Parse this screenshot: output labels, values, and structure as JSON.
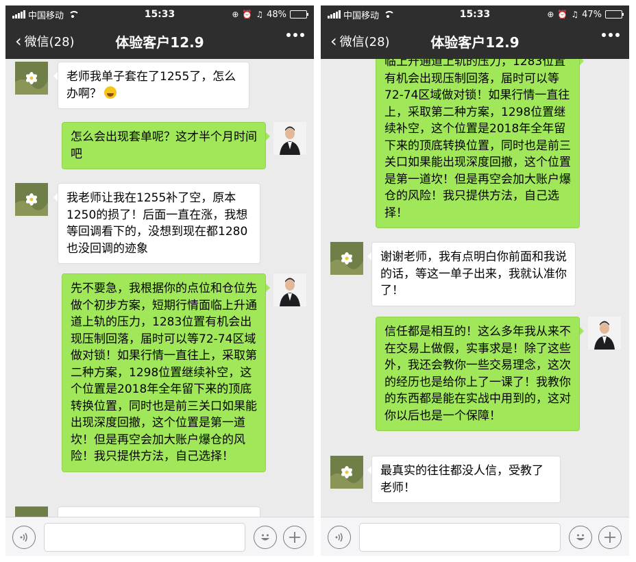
{
  "status": {
    "carrier": "中国移动",
    "time": "15:33",
    "battery_left": "48%",
    "battery_right": "47%",
    "battery_left_level": 0.48,
    "battery_right_level": 0.47
  },
  "nav": {
    "back_label": "微信(28)",
    "title": "体验客户12.9"
  },
  "left_messages": [
    {
      "side": "in",
      "text": "老师我单子套在了1255了，怎么办啊？",
      "emoji": "sweat-smile-emoji"
    },
    {
      "side": "out",
      "text": "怎么会出现套单呢？这才半个月时间吧"
    },
    {
      "side": "in",
      "text": "我老师让我在1255补了空，原本1250的损了！后面一直在涨，我想等回调看下的，没想到现在都1280也没回调的迹象"
    },
    {
      "side": "out",
      "text": "先不要急，我根据你的点位和仓位先做个初步方案，短期行情面临上升通道上轨的压力，1283位置有机会出现压制回落，届时可以等72-74区域做对锁！如果行情一直往上，采取第二种方案，1298位置继续补空，这个位置是2018年全年留下来的顶底转换位置，同时也是前三关口如果能出现深度回撤，这个位置是第一道坎！但是再空会加大账户爆仓的风险！我只提供方法，自己选择！"
    }
  ],
  "right_messages": [
    {
      "side": "out",
      "text": "临上升通道上轨的压力，1283位置有机会出现压制回落，届时可以等72-74区域做对锁！如果行情一直往上，采取第二种方案，1298位置继续补空，这个位置是2018年全年留下来的顶底转换位置，同时也是前三关口如果能出现深度回撤，这个位置是第一道坎！但是再空会加大账户爆仓的风险！我只提供方法，自己选择！"
    },
    {
      "side": "in",
      "text": "谢谢老师，我有点明白你前面和我说的话，等这一单子出来，我就认准你了！"
    },
    {
      "side": "out",
      "text": "信任都是相互的！这么多年我从来不在交易上做假，实事求是！除了这些外，我还会教你一些交易理念，这次的经历也是给你上了一课了！我教你的东西都是能在实战中用到的，这对你以后也是一个保障！"
    },
    {
      "side": "in",
      "text": "最真实的往往都没人信，受教了老师！"
    }
  ],
  "input": {
    "voice_icon": "voice-icon",
    "emoji_icon": "emoji-icon",
    "add_icon": "plus-icon"
  }
}
